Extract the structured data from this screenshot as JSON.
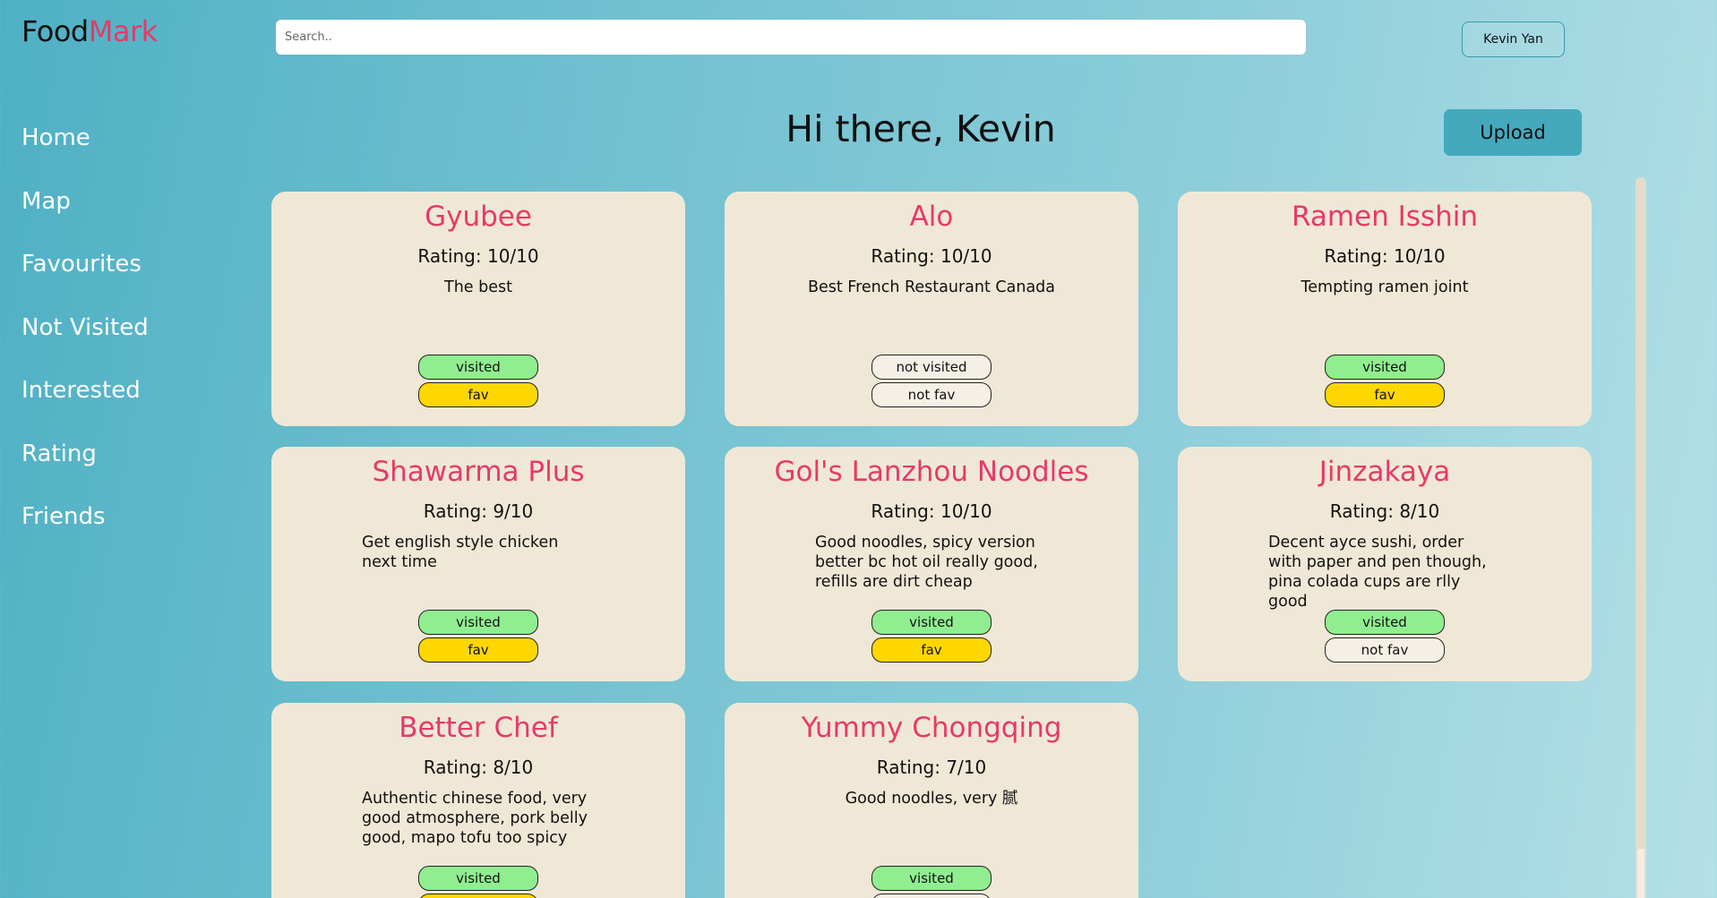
{
  "brand": {
    "part1": "Food",
    "part2": "Mark"
  },
  "search": {
    "placeholder": "Search.."
  },
  "user": {
    "name": "Kevin Yan"
  },
  "nav": [
    "Home",
    "Map",
    "Favourites",
    "Not Visited",
    "Interested",
    "Rating",
    "Friends"
  ],
  "greeting": "Hi there, Kevin",
  "upload_label": "Upload",
  "colors": {
    "accent": "#e8396a",
    "visited": "#90ee90",
    "fav": "#ffd700",
    "card": "#f0e8d6"
  },
  "cards": [
    {
      "name": "Gyubee",
      "rating": "Rating: 10/10",
      "desc": "The best",
      "status": "visited",
      "fav": "fav"
    },
    {
      "name": "Alo",
      "rating": "Rating: 10/10",
      "desc": "Best French Restaurant Canada",
      "status": "not visited",
      "fav": "not fav"
    },
    {
      "name": "Ramen Isshin",
      "rating": "Rating: 10/10",
      "desc": "Tempting ramen joint",
      "status": "visited",
      "fav": "fav"
    },
    {
      "name": "Shawarma Plus",
      "rating": "Rating: 9/10",
      "desc": "Get english style chicken next time",
      "status": "visited",
      "fav": "fav"
    },
    {
      "name": "Gol's Lanzhou Noodles",
      "rating": "Rating: 10/10",
      "desc": "Good noodles, spicy version better bc hot oil really good, refills are dirt cheap",
      "status": "visited",
      "fav": "fav"
    },
    {
      "name": "Jinzakaya",
      "rating": "Rating: 8/10",
      "desc": "Decent ayce sushi, order with paper and pen though, pina colada cups are rlly good",
      "status": "visited",
      "fav": "not fav"
    },
    {
      "name": "Better Chef",
      "rating": "Rating: 8/10",
      "desc": "Authentic chinese food, very good atmosphere, pork belly good, mapo tofu too spicy",
      "status": "visited",
      "fav": ""
    },
    {
      "name": "Yummy Chongqing",
      "rating": "Rating: 7/10",
      "desc": "Good noodles, very 腻",
      "status": "visited",
      "fav": ""
    }
  ]
}
